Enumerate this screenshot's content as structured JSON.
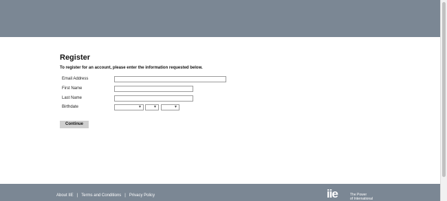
{
  "form": {
    "title": "Register",
    "intro": "To register for an account, please enter the information requested below.",
    "fields": {
      "email": {
        "label": "Email Address",
        "value": ""
      },
      "first_name": {
        "label": "First Name",
        "value": ""
      },
      "last_name": {
        "label": "Last Name",
        "value": ""
      },
      "birthdate": {
        "label": "Birthdate",
        "month": "",
        "day": "",
        "year": ""
      }
    },
    "continue_label": "Continue"
  },
  "footer": {
    "links": [
      "About IIE",
      "Terms and Conditions",
      "Privacy Policy"
    ],
    "separator": "|",
    "logo_mark": "iie",
    "logo_tagline_1": "The Power",
    "logo_tagline_2": "of International"
  },
  "colors": {
    "header_band": "#7b8794",
    "footer_band": "#7b8794",
    "button": "#cfcfcf"
  },
  "icons": {
    "select_arrow": "chevron-down-icon"
  }
}
